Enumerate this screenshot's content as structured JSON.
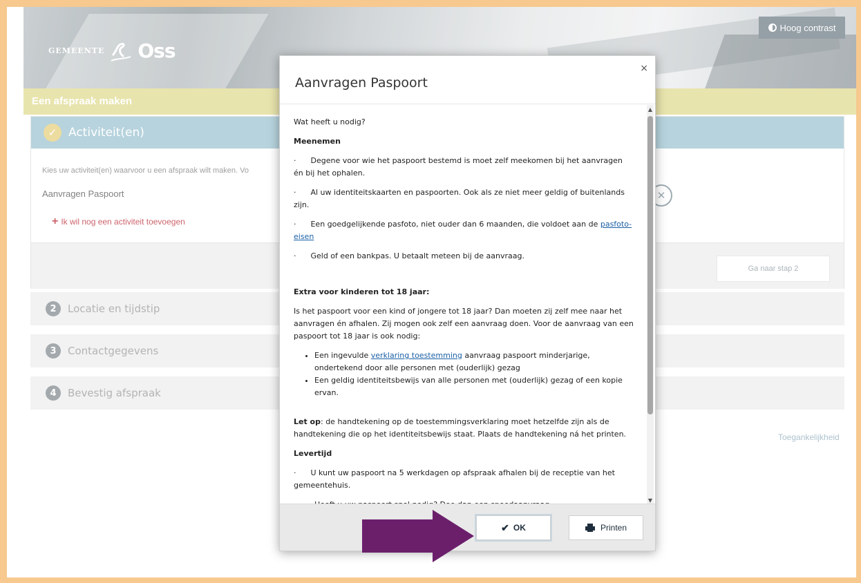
{
  "header": {
    "logo_prefix": "Gemeente",
    "logo_name": "Oss",
    "contrast_label": "Hoog contrast",
    "page_title": "Een afspraak maken"
  },
  "step1": {
    "title": "Activiteit(en)",
    "intro": "Kies uw activiteit(en) waarvoor u een afspraak wilt maken. Vo",
    "activity": "Aanvragen Paspoort",
    "add_label": "Ik wil nog een activiteit toevoegen",
    "next_label": "Ga naar stap 2"
  },
  "steps": [
    {
      "number": "2",
      "label": "Locatie en tijdstip"
    },
    {
      "number": "3",
      "label": "Contactgegevens"
    },
    {
      "number": "4",
      "label": "Bevestig afspraak"
    }
  ],
  "accessibility_link": "Toegankelijkheid",
  "modal": {
    "title": "Aanvragen Paspoort",
    "close_symbol": "×",
    "question": "Wat heeft u nodig?",
    "meenemen_heading": "Meenemen",
    "meenemen_items": [
      "Degene voor wie het paspoort bestemd is moet zelf meekomen bij het aanvragen én bij het ophalen.",
      "Al uw identiteitskaarten en paspoorten. Ook als ze niet meer geldig of buitenlands zijn.",
      "Een goedgelijkende pasfoto, niet ouder dan 6 maanden, die voldoet aan de",
      "Geld of een bankpas. U betaalt meteen bij de aanvraag."
    ],
    "pasfoto_link": "pasfoto-eisen",
    "kinderen_heading": "Extra voor kinderen tot 18 jaar:",
    "kinderen_text": "Is het paspoort voor een kind of jongere tot 18 jaar? Dan moeten zij zelf mee naar het aanvragen én afhalen. Zij mogen ook zelf een aanvraag doen. Voor de aanvraag van een paspoort tot 18 jaar is ook nodig:",
    "kinderen_b1_pre": "Een ingevulde",
    "kinderen_b1_link": "verklaring toestemming",
    "kinderen_b1_post": "aanvraag paspoort minderjarige, ondertekend door alle personen met (ouderlijk) gezag",
    "kinderen_b2": "Een geldig identiteitsbewijs van alle personen met (ouderlijk) gezag of een kopie ervan.",
    "letop_label": "Let op",
    "letop_text": ": de handtekening op de toestemmingsverklaring moet hetzelfde zijn als de handtekening die op het identiteitsbewijs staat. Plaats de handtekening ná het printen.",
    "levertijd_heading": "Levertijd",
    "levertijd_text": "U kunt uw paspoort na 5 werkdagen op afspraak afhalen bij de receptie van het gemeentehuis.",
    "levertijd_bullet": "Heeft u uw paspoort snel nodig? Doe dan een spoedaanvraag.",
    "ok_label": "OK",
    "print_label": "Printen",
    "scroll_up": "▲",
    "scroll_down": "▼"
  },
  "colors": {
    "border_frame": "#f7c98f",
    "title_bar": "#e3df9c",
    "step1_head": "#a8cad6",
    "arrow": "#6b1f6b",
    "link": "#1a5fa6",
    "add_link": "#c2414b"
  }
}
